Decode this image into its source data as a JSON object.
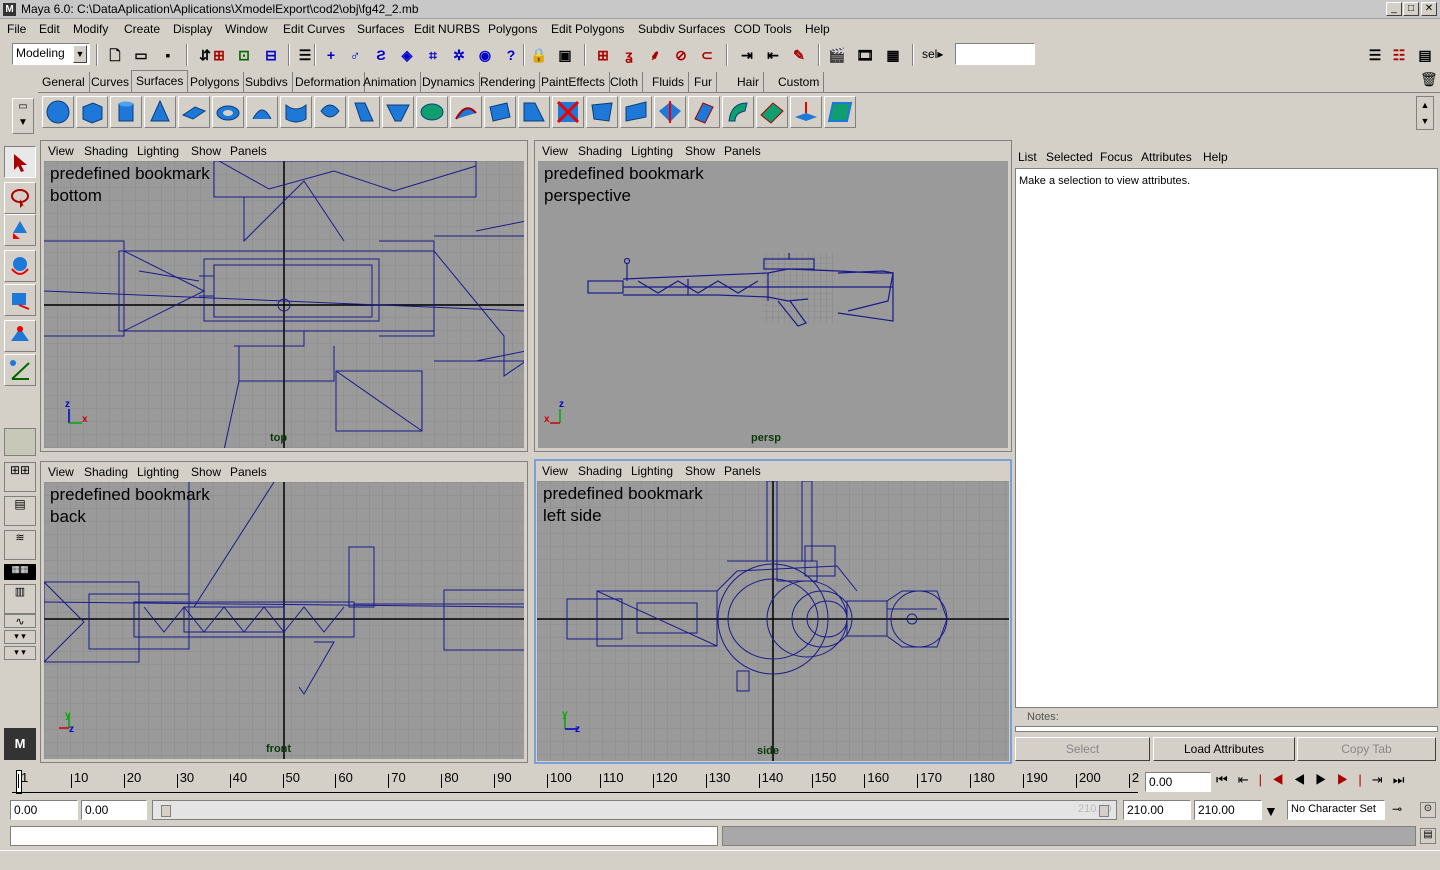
{
  "window": {
    "title": "Maya 6.0: C:\\DataAplication\\Aplications\\XmodelExport\\cod2\\obj\\fg42_2.mb",
    "minimize": "_",
    "maximize": "□",
    "close": "✕"
  },
  "menubar": [
    "File",
    "Edit",
    "Modify",
    "Create",
    "Display",
    "Window",
    "Edit Curves",
    "Surfaces",
    "Edit NURBS",
    "Polygons",
    "Edit Polygons",
    "Subdiv Surfaces",
    "COD Tools",
    "Help"
  ],
  "status_line": {
    "mode": "Modeling",
    "sel_label": "sel▸",
    "sel_value": ""
  },
  "shelf_tabs": [
    "General",
    "Curves",
    "Surfaces",
    "Polygons",
    "Subdivs",
    "Deformation",
    "Animation",
    "Dynamics",
    "Rendering",
    "PaintEffects",
    "Cloth",
    "Fluids",
    "Fur",
    "Hair",
    "Custom"
  ],
  "shelf_active": "Surfaces",
  "panel_menu": [
    "View",
    "Shading",
    "Lighting",
    "Show",
    "Panels"
  ],
  "viewports": [
    {
      "bookmark_line1": "predefined bookmark",
      "bookmark_line2": "bottom",
      "camera": "top",
      "axis_a": "z",
      "axis_b": "x"
    },
    {
      "bookmark_line1": "predefined bookmark",
      "bookmark_line2": "perspective",
      "camera": "persp",
      "axis_a": "z",
      "axis_b": "x"
    },
    {
      "bookmark_line1": "predefined bookmark",
      "bookmark_line2": "back",
      "camera": "front",
      "axis_a": "y",
      "axis_b": "z"
    },
    {
      "bookmark_line1": "predefined bookmark",
      "bookmark_line2": "left side",
      "camera": "side",
      "axis_a": "y",
      "axis_b": "z"
    }
  ],
  "attribute_editor": {
    "menu": [
      "List",
      "Selected",
      "Focus",
      "Attributes",
      "Help"
    ],
    "message": "Make a selection to view attributes.",
    "notes_label": "Notes:",
    "buttons": {
      "select": "Select",
      "load": "Load Attributes",
      "copy": "Copy Tab"
    }
  },
  "time_slider": {
    "labels": [
      "1",
      "10",
      "20",
      "30",
      "40",
      "50",
      "60",
      "70",
      "80",
      "90",
      "100",
      "110",
      "120",
      "130",
      "140",
      "150",
      "160",
      "170",
      "180",
      "190",
      "200",
      "2"
    ],
    "current_time": "0.00"
  },
  "range_slider": {
    "start": "0.00",
    "playback_start": "0.00",
    "range_end_ghost": "210.00",
    "playback_end": "210.00",
    "anim_end": "210.00",
    "character_set": "No Character Set"
  },
  "colors": {
    "wire": "#1a1a8c",
    "grid": "#8a8a8a",
    "viewport_bg": "#9a9a9a",
    "active_border": "#7aa0d8"
  }
}
